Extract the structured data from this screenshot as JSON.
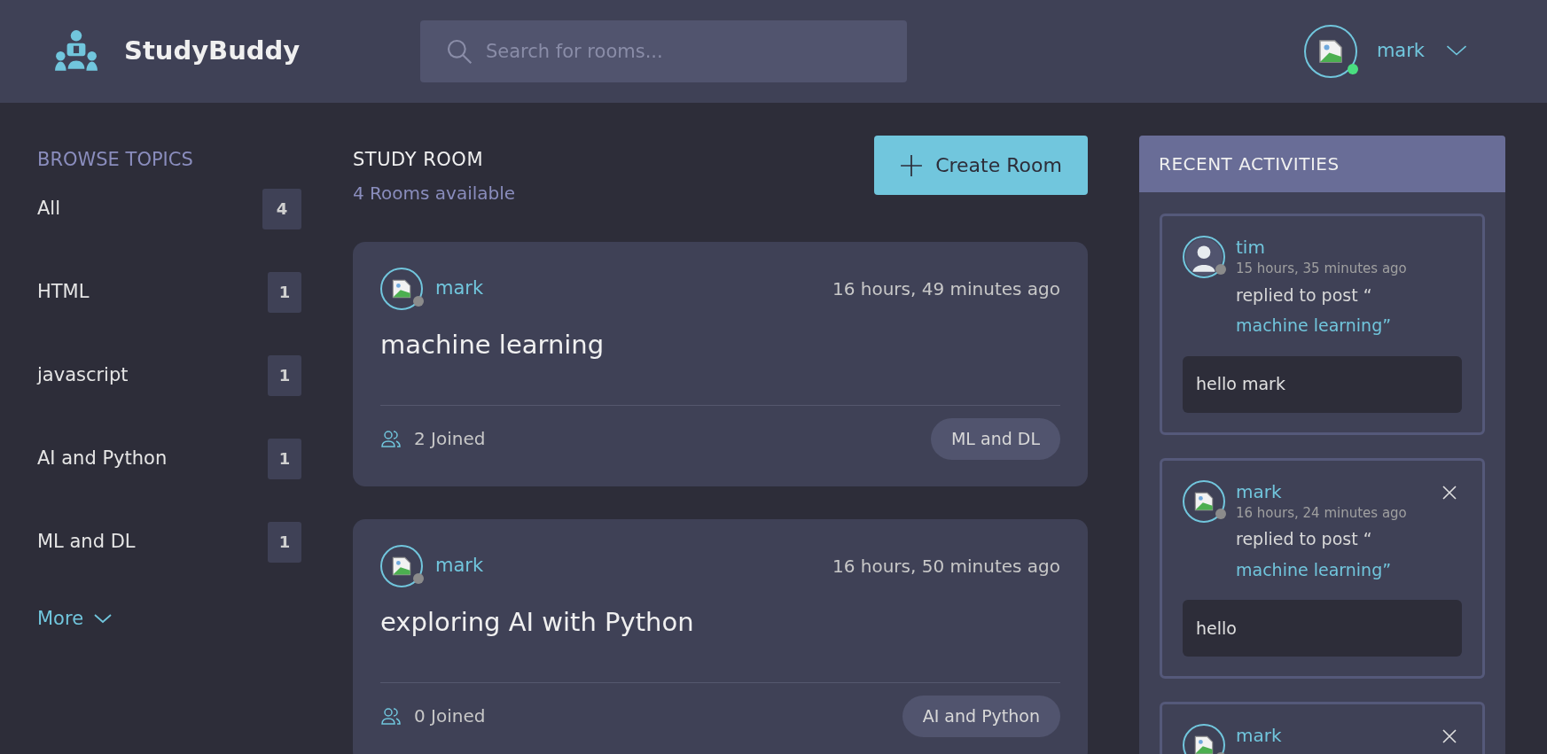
{
  "header": {
    "brand": "StudyBuddy",
    "search": {
      "placeholder": "Search for rooms..."
    },
    "user": {
      "name": "mark",
      "online": true,
      "silhouette": false
    }
  },
  "sidebar": {
    "title": "BROWSE TOPICS",
    "topics": [
      {
        "label": "All",
        "count": "4"
      },
      {
        "label": "HTML",
        "count": "1"
      },
      {
        "label": "javascript",
        "count": "1"
      },
      {
        "label": "AI and Python",
        "count": "1"
      },
      {
        "label": "ML and DL",
        "count": "1"
      }
    ],
    "more": "More"
  },
  "main": {
    "title": "STUDY ROOM",
    "subtitle": "4 Rooms available",
    "create_button": "Create Room",
    "rooms": [
      {
        "host": "mark",
        "online": false,
        "silhouette": false,
        "time": "16 hours, 49 minutes ago",
        "name": "machine learning",
        "joined": "2 Joined",
        "topic": "ML and DL"
      },
      {
        "host": "mark",
        "online": false,
        "silhouette": false,
        "time": "16 hours, 50 minutes ago",
        "name": "exploring AI with Python",
        "joined": "0 Joined",
        "topic": "AI and Python"
      }
    ]
  },
  "activities": {
    "title": "RECENT ACTIVITIES",
    "items": [
      {
        "user": "tim",
        "online": false,
        "silhouette": true,
        "deletable": false,
        "time": "15 hours, 35 minutes ago",
        "action": "replied to post “",
        "post": "machine learning”",
        "message": "hello mark"
      },
      {
        "user": "mark",
        "online": false,
        "silhouette": false,
        "deletable": true,
        "time": "16 hours, 24 minutes ago",
        "action": "replied to post “",
        "post": "machine learning”",
        "message": "hello"
      },
      {
        "user": "mark",
        "online": false,
        "silhouette": false,
        "deletable": true
      }
    ]
  }
}
